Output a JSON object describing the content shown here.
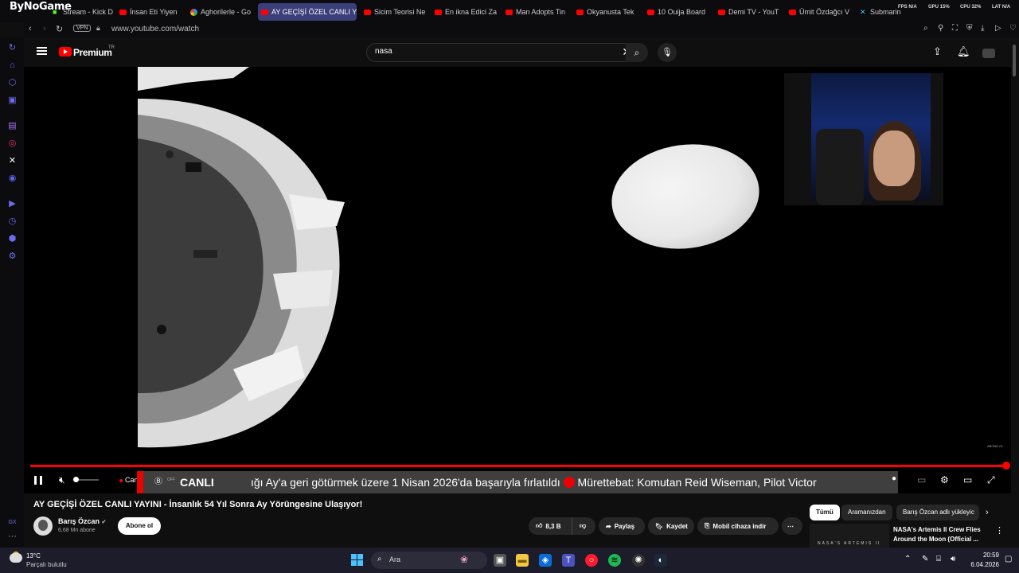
{
  "watermark": "ByNoGame",
  "tabs": [
    {
      "label": "Stream - Kick D",
      "icon": "kick"
    },
    {
      "label": "İnsan Eti Yiyen",
      "icon": "youtube"
    },
    {
      "label": "Aghorilerle - Go",
      "icon": "google"
    },
    {
      "label": "AY GEÇİŞİ ÖZEL CANLI YA",
      "icon": "youtube",
      "active": true
    },
    {
      "label": "Sicim Teorisi Ne",
      "icon": "youtube"
    },
    {
      "label": "En ikna Edici Za",
      "icon": "youtube"
    },
    {
      "label": "Man Adopts Tin",
      "icon": "youtube"
    },
    {
      "label": "Okyanusta Tek",
      "icon": "youtube"
    },
    {
      "label": "10 Ouija Board",
      "icon": "youtube"
    },
    {
      "label": "Demi TV - YouT",
      "icon": "youtube"
    },
    {
      "label": "Ümit Özdağcı V",
      "icon": "youtube"
    },
    {
      "label": "Submarine Cab",
      "icon": "x"
    }
  ],
  "stats": {
    "fps": "FPS N/A",
    "gpu": "GPU 15%",
    "cpu": "CPU 32%",
    "lat": "LAT N/A"
  },
  "address": {
    "vpn": "VPN",
    "url": "www.youtube.com/watch"
  },
  "youtube": {
    "brand": "Premium",
    "region": "TR",
    "search_value": "nasa"
  },
  "video": {
    "corner_tag": "ABONE OL",
    "live_label": "Canlı",
    "ticker_off": "OFF",
    "ticker_canli": "CANLI",
    "ticker_text_a": "ığı Ay'a geri götürmek üzere 1 Nisan 2026'da başarıyla fırlatıldı",
    "ticker_text_b": "Mürettebat: Komutan Reid Wiseman, Pilot Victor"
  },
  "info": {
    "title": "AY GEÇİŞİ ÖZEL CANLI YAYINI - İnsanlık 54 Yıl Sonra Ay Yörüngesine Ulaşıyor!",
    "channel": "Barış Özcan",
    "subscribers": "6,68 Mn abone",
    "subscribe": "Abone ol",
    "likes": "8,3 B",
    "share": "Paylaş",
    "save": "Kaydet",
    "download": "Mobil cihaza indir"
  },
  "chips": [
    "Tümü",
    "Aramanızdan",
    "Barış Özcan adlı yükleyic"
  ],
  "related": {
    "thumb_text": "NASA'S ARTEMIS II",
    "title": "NASA's Artemis II Crew Flies Around the Moon (Official ..."
  },
  "taskbar": {
    "temp": "13°C",
    "weather": "Parçalı bulutlu",
    "search": "Ara",
    "time": "20:59",
    "date": "6.04.2026"
  }
}
